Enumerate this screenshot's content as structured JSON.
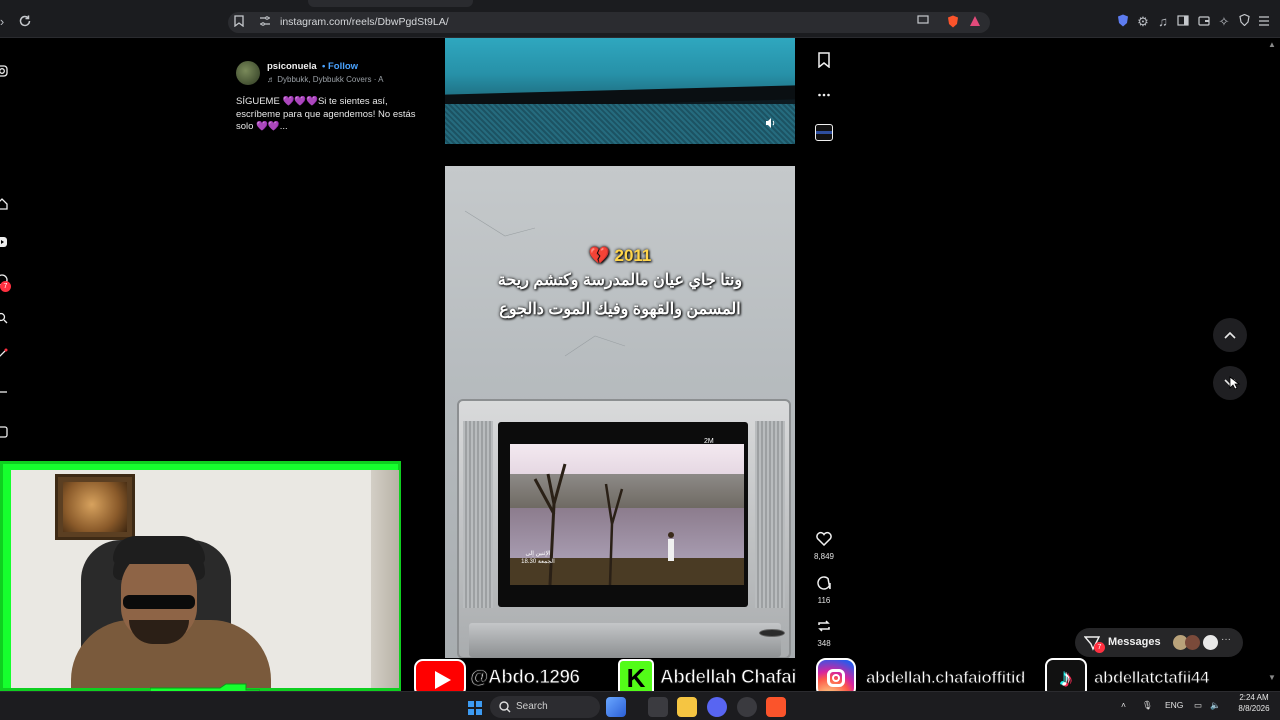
{
  "browser": {
    "url": "instagram.com/reels/DbwPgdSt9LA/"
  },
  "post": {
    "username": "psiconuela",
    "separator": "•",
    "follow_label": "Follow",
    "audio": "Dybbukk, Dybbukk Covers · A",
    "caption": "SÍGUEME 💜💜💜Si te sientes así, escríbeme para que agendemos! No estás solo 💜💜...",
    "year": "💔 2011",
    "overlay_line1": "ونتا جاي عيان مالمدرسة وكتشم ريحة",
    "overlay_line2": "المسمن والقهوة وفيك الموت دالجوع",
    "tv_subtitle": "الإثنين إلى الجمعة 18.30",
    "tv_channel": "2M"
  },
  "actions": {
    "likes": "8,849",
    "comments": "116",
    "reposts": "348"
  },
  "sidebar": {
    "notification_count": "7"
  },
  "messages": {
    "label": "Messages",
    "badge": "7"
  },
  "banner": {
    "youtube": "@Abdo.1296",
    "kick": "Abdellah Chafai",
    "instagram": "abdellah.chafaioffitid",
    "tiktok": "abdellatctafii44",
    "kick_letter": "K",
    "tiktok_glyph": "♪"
  },
  "taskbar": {
    "search_label": "Search",
    "language": "ENG",
    "time": "2:24 AM",
    "date": "8/8/2026"
  },
  "colors": {
    "accent_follow": "#4aa3ff",
    "badge": "#ff3040",
    "webcam_border": "#16ff2e"
  }
}
